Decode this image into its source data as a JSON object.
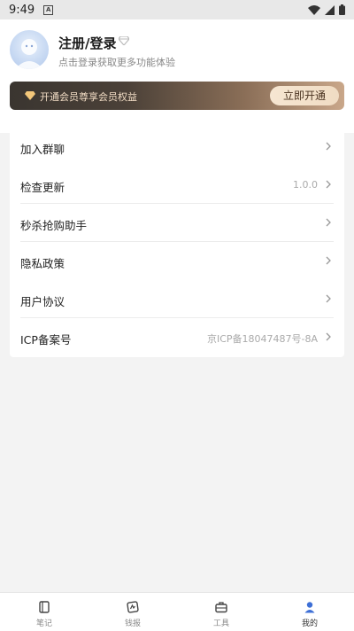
{
  "status_bar": {
    "time": "9:49",
    "notification_letter": "A"
  },
  "header": {
    "login_title": "注册/登录",
    "login_subtitle": "点击登录获取更多功能体验"
  },
  "vip": {
    "text": "开通会员尊享会员权益",
    "button_label": "立即开通",
    "accent": "#f1dcc4"
  },
  "menu": {
    "items": [
      {
        "label": "加入群聊",
        "value": ""
      },
      {
        "label": "检查更新",
        "value": "1.0.0"
      },
      {
        "label": "秒杀抢购助手",
        "value": ""
      },
      {
        "label": "隐私政策",
        "value": ""
      },
      {
        "label": "用户协议",
        "value": ""
      },
      {
        "label": "ICP备案号",
        "value": "京ICP备18047487号-8A"
      }
    ]
  },
  "tabbar": {
    "tabs": [
      {
        "label": "笔记",
        "icon": "notebook-icon",
        "active": false
      },
      {
        "label": "钱报",
        "icon": "report-icon",
        "active": false
      },
      {
        "label": "工具",
        "icon": "toolbox-icon",
        "active": false
      },
      {
        "label": "我的",
        "icon": "person-icon",
        "active": true
      }
    ],
    "active_color": "#3d6fd6"
  }
}
